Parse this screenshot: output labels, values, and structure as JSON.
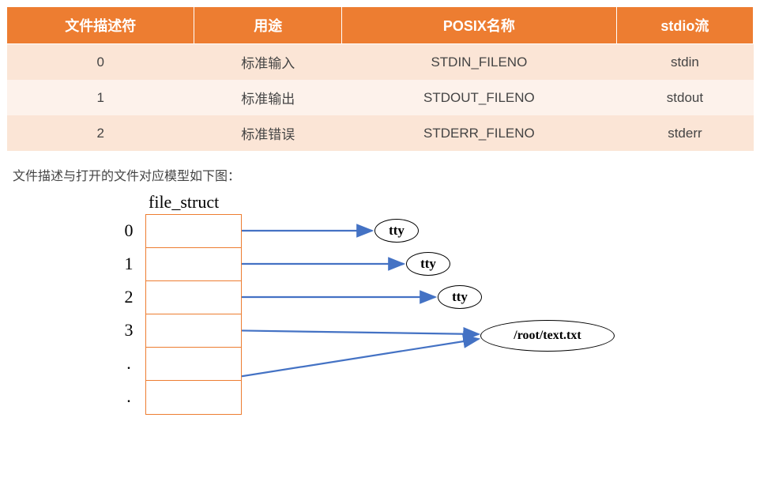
{
  "table": {
    "headers": [
      "文件描述符",
      "用途",
      "POSIX名称",
      "stdio流"
    ],
    "rows": [
      {
        "fd": "0",
        "usage": "标准输入",
        "posix": "STDIN_FILENO",
        "stdio": "stdin"
      },
      {
        "fd": "1",
        "usage": "标准输出",
        "posix": "STDOUT_FILENO",
        "stdio": "stdout"
      },
      {
        "fd": "2",
        "usage": "标准错误",
        "posix": "STDERR_FILENO",
        "stdio": "stderr"
      }
    ]
  },
  "caption": "文件描述与打开的文件对应模型如下图：",
  "diagram": {
    "struct_label": "file_struct",
    "indices": [
      "0",
      "1",
      "2",
      "3",
      ".",
      "."
    ],
    "nodes": [
      "tty",
      "tty",
      "tty",
      "/root/text.txt"
    ]
  }
}
